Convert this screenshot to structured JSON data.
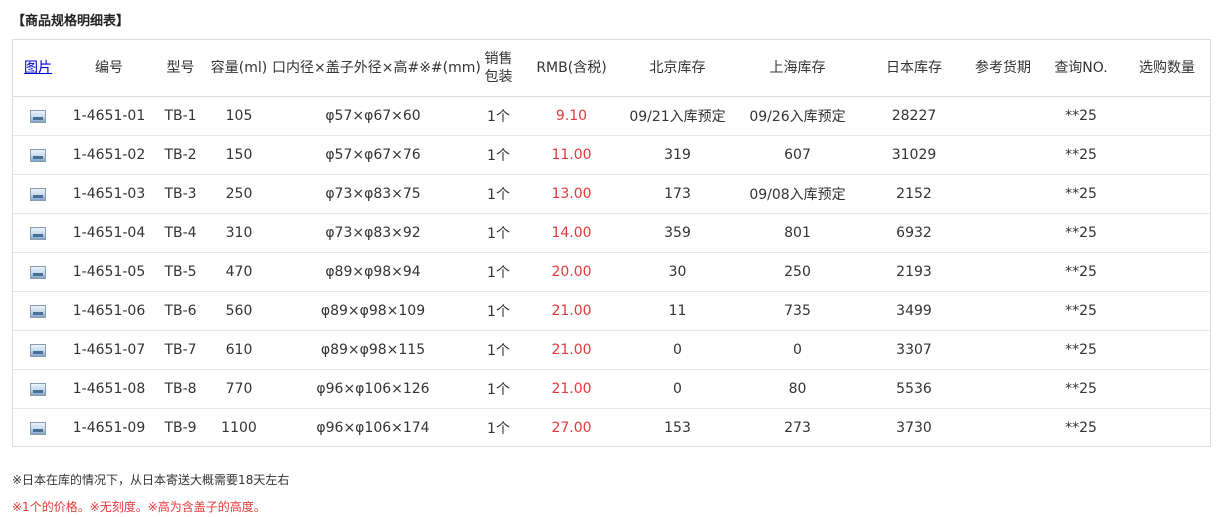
{
  "title": "【商品规格明细表】",
  "table": {
    "headers": {
      "image": "图片",
      "code": "编号",
      "model": "型号",
      "capacity": "容量(ml)",
      "dimensions": "口内径×盖子外径×高#※#(mm)",
      "pack_line1": "销售",
      "pack_line2": "包装",
      "price": "RMB(含税)",
      "beijing": "北京库存",
      "shanghai": "上海库存",
      "japan": "日本库存",
      "delivery": "参考货期",
      "query": "查询NO.",
      "quantity": "选购数量"
    },
    "rows": [
      {
        "code": "1-4651-01",
        "model": "TB-1",
        "capacity": "105",
        "dimensions": "φ57×φ67×60",
        "pack": "1个",
        "price": "9.10",
        "beijing": "09/21入库预定",
        "shanghai": "09/26入库预定",
        "japan": "28227",
        "delivery": "",
        "query": "**25",
        "quantity": ""
      },
      {
        "code": "1-4651-02",
        "model": "TB-2",
        "capacity": "150",
        "dimensions": "φ57×φ67×76",
        "pack": "1个",
        "price": "11.00",
        "beijing": "319",
        "shanghai": "607",
        "japan": "31029",
        "delivery": "",
        "query": "**25",
        "quantity": ""
      },
      {
        "code": "1-4651-03",
        "model": "TB-3",
        "capacity": "250",
        "dimensions": "φ73×φ83×75",
        "pack": "1个",
        "price": "13.00",
        "beijing": "173",
        "shanghai": "09/08入库预定",
        "japan": "2152",
        "delivery": "",
        "query": "**25",
        "quantity": ""
      },
      {
        "code": "1-4651-04",
        "model": "TB-4",
        "capacity": "310",
        "dimensions": "φ73×φ83×92",
        "pack": "1个",
        "price": "14.00",
        "beijing": "359",
        "shanghai": "801",
        "japan": "6932",
        "delivery": "",
        "query": "**25",
        "quantity": ""
      },
      {
        "code": "1-4651-05",
        "model": "TB-5",
        "capacity": "470",
        "dimensions": "φ89×φ98×94",
        "pack": "1个",
        "price": "20.00",
        "beijing": "30",
        "shanghai": "250",
        "japan": "2193",
        "delivery": "",
        "query": "**25",
        "quantity": ""
      },
      {
        "code": "1-4651-06",
        "model": "TB-6",
        "capacity": "560",
        "dimensions": "φ89×φ98×109",
        "pack": "1个",
        "price": "21.00",
        "beijing": "11",
        "shanghai": "735",
        "japan": "3499",
        "delivery": "",
        "query": "**25",
        "quantity": ""
      },
      {
        "code": "1-4651-07",
        "model": "TB-7",
        "capacity": "610",
        "dimensions": "φ89×φ98×115",
        "pack": "1个",
        "price": "21.00",
        "beijing": "0",
        "shanghai": "0",
        "japan": "3307",
        "delivery": "",
        "query": "**25",
        "quantity": ""
      },
      {
        "code": "1-4651-08",
        "model": "TB-8",
        "capacity": "770",
        "dimensions": "φ96×φ106×126",
        "pack": "1个",
        "price": "21.00",
        "beijing": "0",
        "shanghai": "80",
        "japan": "5536",
        "delivery": "",
        "query": "**25",
        "quantity": ""
      },
      {
        "code": "1-4651-09",
        "model": "TB-9",
        "capacity": "1100",
        "dimensions": "φ96×φ106×174",
        "pack": "1个",
        "price": "27.00",
        "beijing": "153",
        "shanghai": "273",
        "japan": "3730",
        "delivery": "",
        "query": "**25",
        "quantity": ""
      }
    ]
  },
  "notes": {
    "shipping": "※日本在库的情况下，从日本寄送大概需要18天左右",
    "remarks": "※1个的价格。※无刻度。※高为含盖子的高度。"
  },
  "colors": {
    "price": "#e4393c",
    "link": "#0000cc",
    "border": "#dddddd"
  }
}
